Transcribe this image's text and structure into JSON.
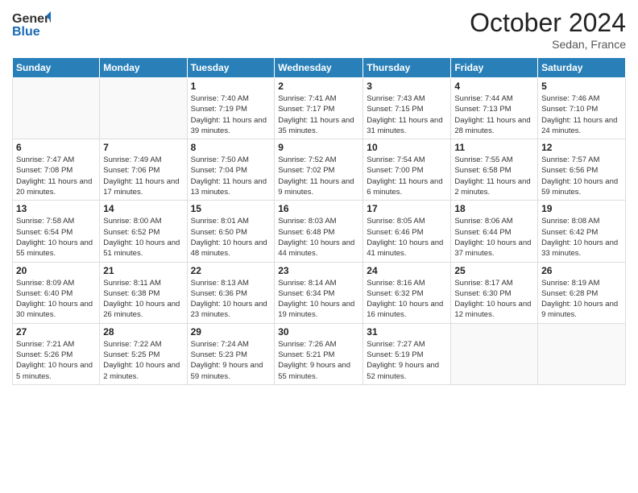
{
  "logo": {
    "general": "General",
    "blue": "Blue"
  },
  "header": {
    "month": "October 2024",
    "location": "Sedan, France"
  },
  "weekdays": [
    "Sunday",
    "Monday",
    "Tuesday",
    "Wednesday",
    "Thursday",
    "Friday",
    "Saturday"
  ],
  "weeks": [
    [
      {
        "day": "",
        "info": ""
      },
      {
        "day": "",
        "info": ""
      },
      {
        "day": "1",
        "info": "Sunrise: 7:40 AM\nSunset: 7:19 PM\nDaylight: 11 hours and 39 minutes."
      },
      {
        "day": "2",
        "info": "Sunrise: 7:41 AM\nSunset: 7:17 PM\nDaylight: 11 hours and 35 minutes."
      },
      {
        "day": "3",
        "info": "Sunrise: 7:43 AM\nSunset: 7:15 PM\nDaylight: 11 hours and 31 minutes."
      },
      {
        "day": "4",
        "info": "Sunrise: 7:44 AM\nSunset: 7:13 PM\nDaylight: 11 hours and 28 minutes."
      },
      {
        "day": "5",
        "info": "Sunrise: 7:46 AM\nSunset: 7:10 PM\nDaylight: 11 hours and 24 minutes."
      }
    ],
    [
      {
        "day": "6",
        "info": "Sunrise: 7:47 AM\nSunset: 7:08 PM\nDaylight: 11 hours and 20 minutes."
      },
      {
        "day": "7",
        "info": "Sunrise: 7:49 AM\nSunset: 7:06 PM\nDaylight: 11 hours and 17 minutes."
      },
      {
        "day": "8",
        "info": "Sunrise: 7:50 AM\nSunset: 7:04 PM\nDaylight: 11 hours and 13 minutes."
      },
      {
        "day": "9",
        "info": "Sunrise: 7:52 AM\nSunset: 7:02 PM\nDaylight: 11 hours and 9 minutes."
      },
      {
        "day": "10",
        "info": "Sunrise: 7:54 AM\nSunset: 7:00 PM\nDaylight: 11 hours and 6 minutes."
      },
      {
        "day": "11",
        "info": "Sunrise: 7:55 AM\nSunset: 6:58 PM\nDaylight: 11 hours and 2 minutes."
      },
      {
        "day": "12",
        "info": "Sunrise: 7:57 AM\nSunset: 6:56 PM\nDaylight: 10 hours and 59 minutes."
      }
    ],
    [
      {
        "day": "13",
        "info": "Sunrise: 7:58 AM\nSunset: 6:54 PM\nDaylight: 10 hours and 55 minutes."
      },
      {
        "day": "14",
        "info": "Sunrise: 8:00 AM\nSunset: 6:52 PM\nDaylight: 10 hours and 51 minutes."
      },
      {
        "day": "15",
        "info": "Sunrise: 8:01 AM\nSunset: 6:50 PM\nDaylight: 10 hours and 48 minutes."
      },
      {
        "day": "16",
        "info": "Sunrise: 8:03 AM\nSunset: 6:48 PM\nDaylight: 10 hours and 44 minutes."
      },
      {
        "day": "17",
        "info": "Sunrise: 8:05 AM\nSunset: 6:46 PM\nDaylight: 10 hours and 41 minutes."
      },
      {
        "day": "18",
        "info": "Sunrise: 8:06 AM\nSunset: 6:44 PM\nDaylight: 10 hours and 37 minutes."
      },
      {
        "day": "19",
        "info": "Sunrise: 8:08 AM\nSunset: 6:42 PM\nDaylight: 10 hours and 33 minutes."
      }
    ],
    [
      {
        "day": "20",
        "info": "Sunrise: 8:09 AM\nSunset: 6:40 PM\nDaylight: 10 hours and 30 minutes."
      },
      {
        "day": "21",
        "info": "Sunrise: 8:11 AM\nSunset: 6:38 PM\nDaylight: 10 hours and 26 minutes."
      },
      {
        "day": "22",
        "info": "Sunrise: 8:13 AM\nSunset: 6:36 PM\nDaylight: 10 hours and 23 minutes."
      },
      {
        "day": "23",
        "info": "Sunrise: 8:14 AM\nSunset: 6:34 PM\nDaylight: 10 hours and 19 minutes."
      },
      {
        "day": "24",
        "info": "Sunrise: 8:16 AM\nSunset: 6:32 PM\nDaylight: 10 hours and 16 minutes."
      },
      {
        "day": "25",
        "info": "Sunrise: 8:17 AM\nSunset: 6:30 PM\nDaylight: 10 hours and 12 minutes."
      },
      {
        "day": "26",
        "info": "Sunrise: 8:19 AM\nSunset: 6:28 PM\nDaylight: 10 hours and 9 minutes."
      }
    ],
    [
      {
        "day": "27",
        "info": "Sunrise: 7:21 AM\nSunset: 5:26 PM\nDaylight: 10 hours and 5 minutes."
      },
      {
        "day": "28",
        "info": "Sunrise: 7:22 AM\nSunset: 5:25 PM\nDaylight: 10 hours and 2 minutes."
      },
      {
        "day": "29",
        "info": "Sunrise: 7:24 AM\nSunset: 5:23 PM\nDaylight: 9 hours and 59 minutes."
      },
      {
        "day": "30",
        "info": "Sunrise: 7:26 AM\nSunset: 5:21 PM\nDaylight: 9 hours and 55 minutes."
      },
      {
        "day": "31",
        "info": "Sunrise: 7:27 AM\nSunset: 5:19 PM\nDaylight: 9 hours and 52 minutes."
      },
      {
        "day": "",
        "info": ""
      },
      {
        "day": "",
        "info": ""
      }
    ]
  ]
}
